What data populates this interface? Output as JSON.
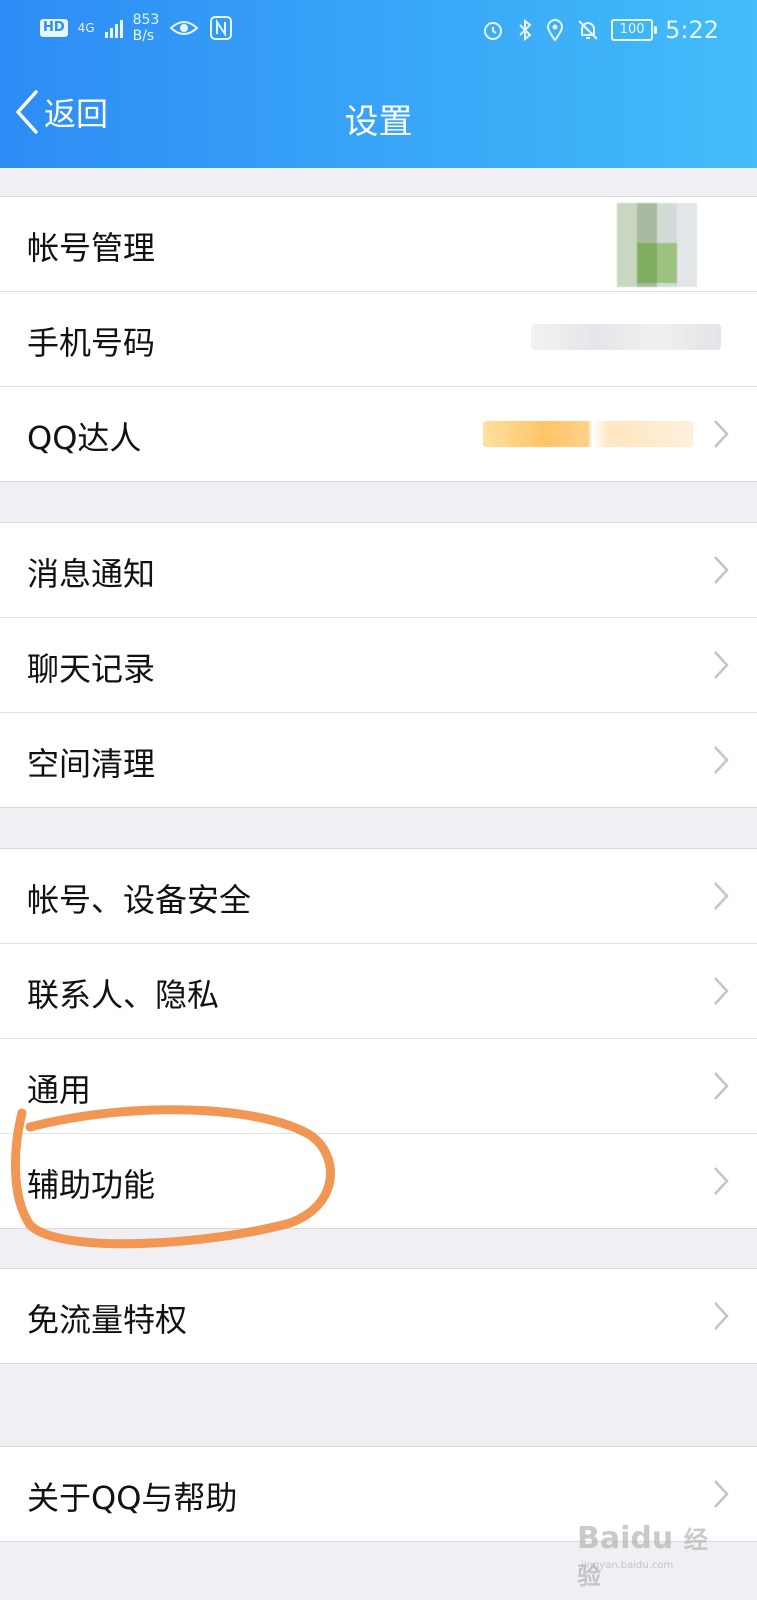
{
  "statusbar": {
    "hd": "HD",
    "network": "4G",
    "speed_value": "853",
    "speed_unit": "B/s",
    "battery": "100",
    "time": "5:22"
  },
  "nav": {
    "back_label": "返回",
    "title": "设置"
  },
  "groups": [
    {
      "items": [
        {
          "label": "帐号管理"
        },
        {
          "label": "手机号码"
        },
        {
          "label": "QQ达人"
        }
      ]
    },
    {
      "items": [
        {
          "label": "消息通知"
        },
        {
          "label": "聊天记录"
        },
        {
          "label": "空间清理"
        }
      ]
    },
    {
      "items": [
        {
          "label": "帐号、设备安全"
        },
        {
          "label": "联系人、隐私"
        },
        {
          "label": "通用"
        },
        {
          "label": "辅助功能"
        }
      ]
    },
    {
      "items": [
        {
          "label": "免流量特权"
        }
      ]
    },
    {
      "items": [
        {
          "label": "关于QQ与帮助"
        }
      ]
    }
  ],
  "annotation": {
    "color": "#f0914a"
  },
  "colors": {
    "header_start": "#2d8cf5",
    "header_end": "#42bdf9",
    "background": "#efeff4"
  },
  "watermark": {
    "brand": "Bai",
    "brand_suffix": "du",
    "product": "经验",
    "url": "jingyan.baidu.com"
  }
}
